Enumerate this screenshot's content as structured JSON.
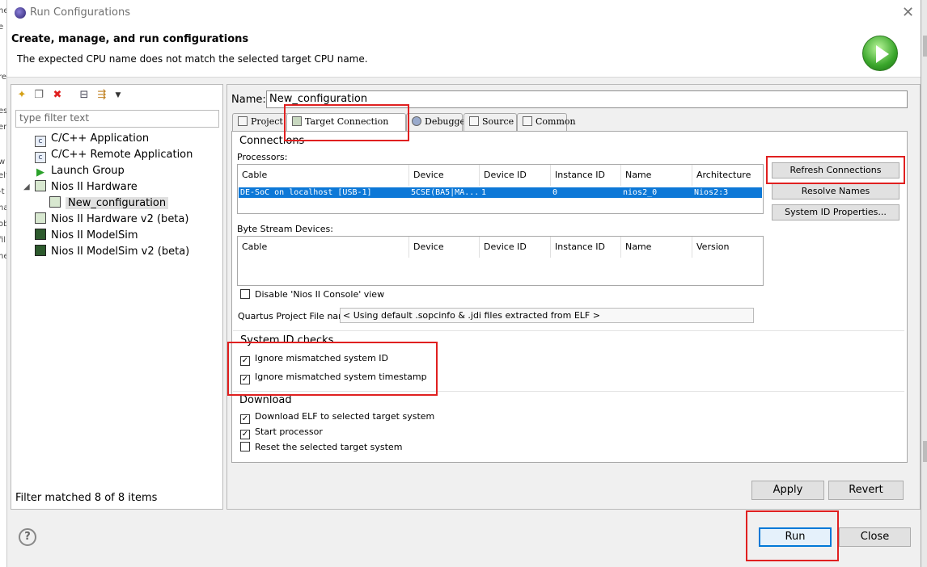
{
  "window": {
    "title": "Run Configurations",
    "close_glyph": "✕"
  },
  "header": {
    "title": "Create, manage, and run configurations",
    "message": "The expected CPU name does not match the selected target CPU name.",
    "icon": "run-icon"
  },
  "left": {
    "toolbar": {
      "new_icon": "new-config-icon",
      "duplicate_icon": "duplicate-icon",
      "delete_icon": "delete-icon",
      "collapse_icon": "collapse-all-icon",
      "filter_icon": "filter-icon",
      "menu_icon": "chevron-down-icon"
    },
    "filter_placeholder": "type filter text",
    "tree": [
      {
        "label": "C/C++ Application",
        "icon": "c-app-icon"
      },
      {
        "label": "C/C++ Remote Application",
        "icon": "c-remote-icon"
      },
      {
        "label": "Launch Group",
        "icon": "launch-group-icon"
      },
      {
        "label": "Nios II Hardware",
        "icon": "nios-hardware-icon",
        "expanded": true
      },
      {
        "label": "New_configuration",
        "icon": "nios-config-icon",
        "selected": true
      },
      {
        "label": "Nios II Hardware v2 (beta)",
        "icon": "nios-hardware-icon"
      },
      {
        "label": "Nios II ModelSim",
        "icon": "modelsim-icon"
      },
      {
        "label": "Nios II ModelSim v2 (beta)",
        "icon": "modelsim-icon"
      }
    ],
    "status": "Filter matched 8 of 8 items"
  },
  "config": {
    "name_label": "Name:",
    "name_value": "New_configuration",
    "tabs": [
      {
        "label": "Project"
      },
      {
        "label": "Target Connection",
        "active": true
      },
      {
        "label": "Debugger"
      },
      {
        "label": "Source"
      },
      {
        "label": "Common"
      }
    ]
  },
  "connections": {
    "title": "Connections",
    "processors_label": "Processors:",
    "processor_columns": [
      "Cable",
      "Device",
      "Device ID",
      "Instance ID",
      "Name",
      "Architecture"
    ],
    "processor_row": [
      "DE-SoC on localhost [USB-1]",
      "5CSE(BA5|MA...",
      "1",
      "0",
      "nios2_0",
      "Nios2:3"
    ],
    "refresh_button": "Refresh Connections",
    "resolve_button": "Resolve Names",
    "sysid_button": "System ID Properties...",
    "bytestream_label": "Byte Stream Devices:",
    "bytestream_columns": [
      "Cable",
      "Device",
      "Device ID",
      "Instance ID",
      "Name",
      "Version"
    ],
    "disable_console_label": "Disable 'Nios II Console' view",
    "disable_console_checked": false,
    "quartus_label": "Quartus Project File name:",
    "quartus_value": "< Using default .sopcinfo & .jdi files extracted from ELF >"
  },
  "sysid": {
    "title": "System ID checks",
    "ignore_id_label": "Ignore mismatched system ID",
    "ignore_id_checked": true,
    "ignore_ts_label": "Ignore mismatched system timestamp",
    "ignore_ts_checked": true
  },
  "download": {
    "title": "Download",
    "download_elf_label": "Download ELF to selected target system",
    "download_elf_checked": true,
    "start_processor_label": "Start processor",
    "start_processor_checked": true,
    "reset_label": "Reset the selected target system",
    "reset_checked": false
  },
  "footer": {
    "apply": "Apply",
    "revert": "Revert",
    "run": "Run",
    "close": "Close",
    "help_glyph": "?"
  },
  "colors": {
    "selection": "#0d78d7",
    "highlight_box": "#e02020"
  }
}
